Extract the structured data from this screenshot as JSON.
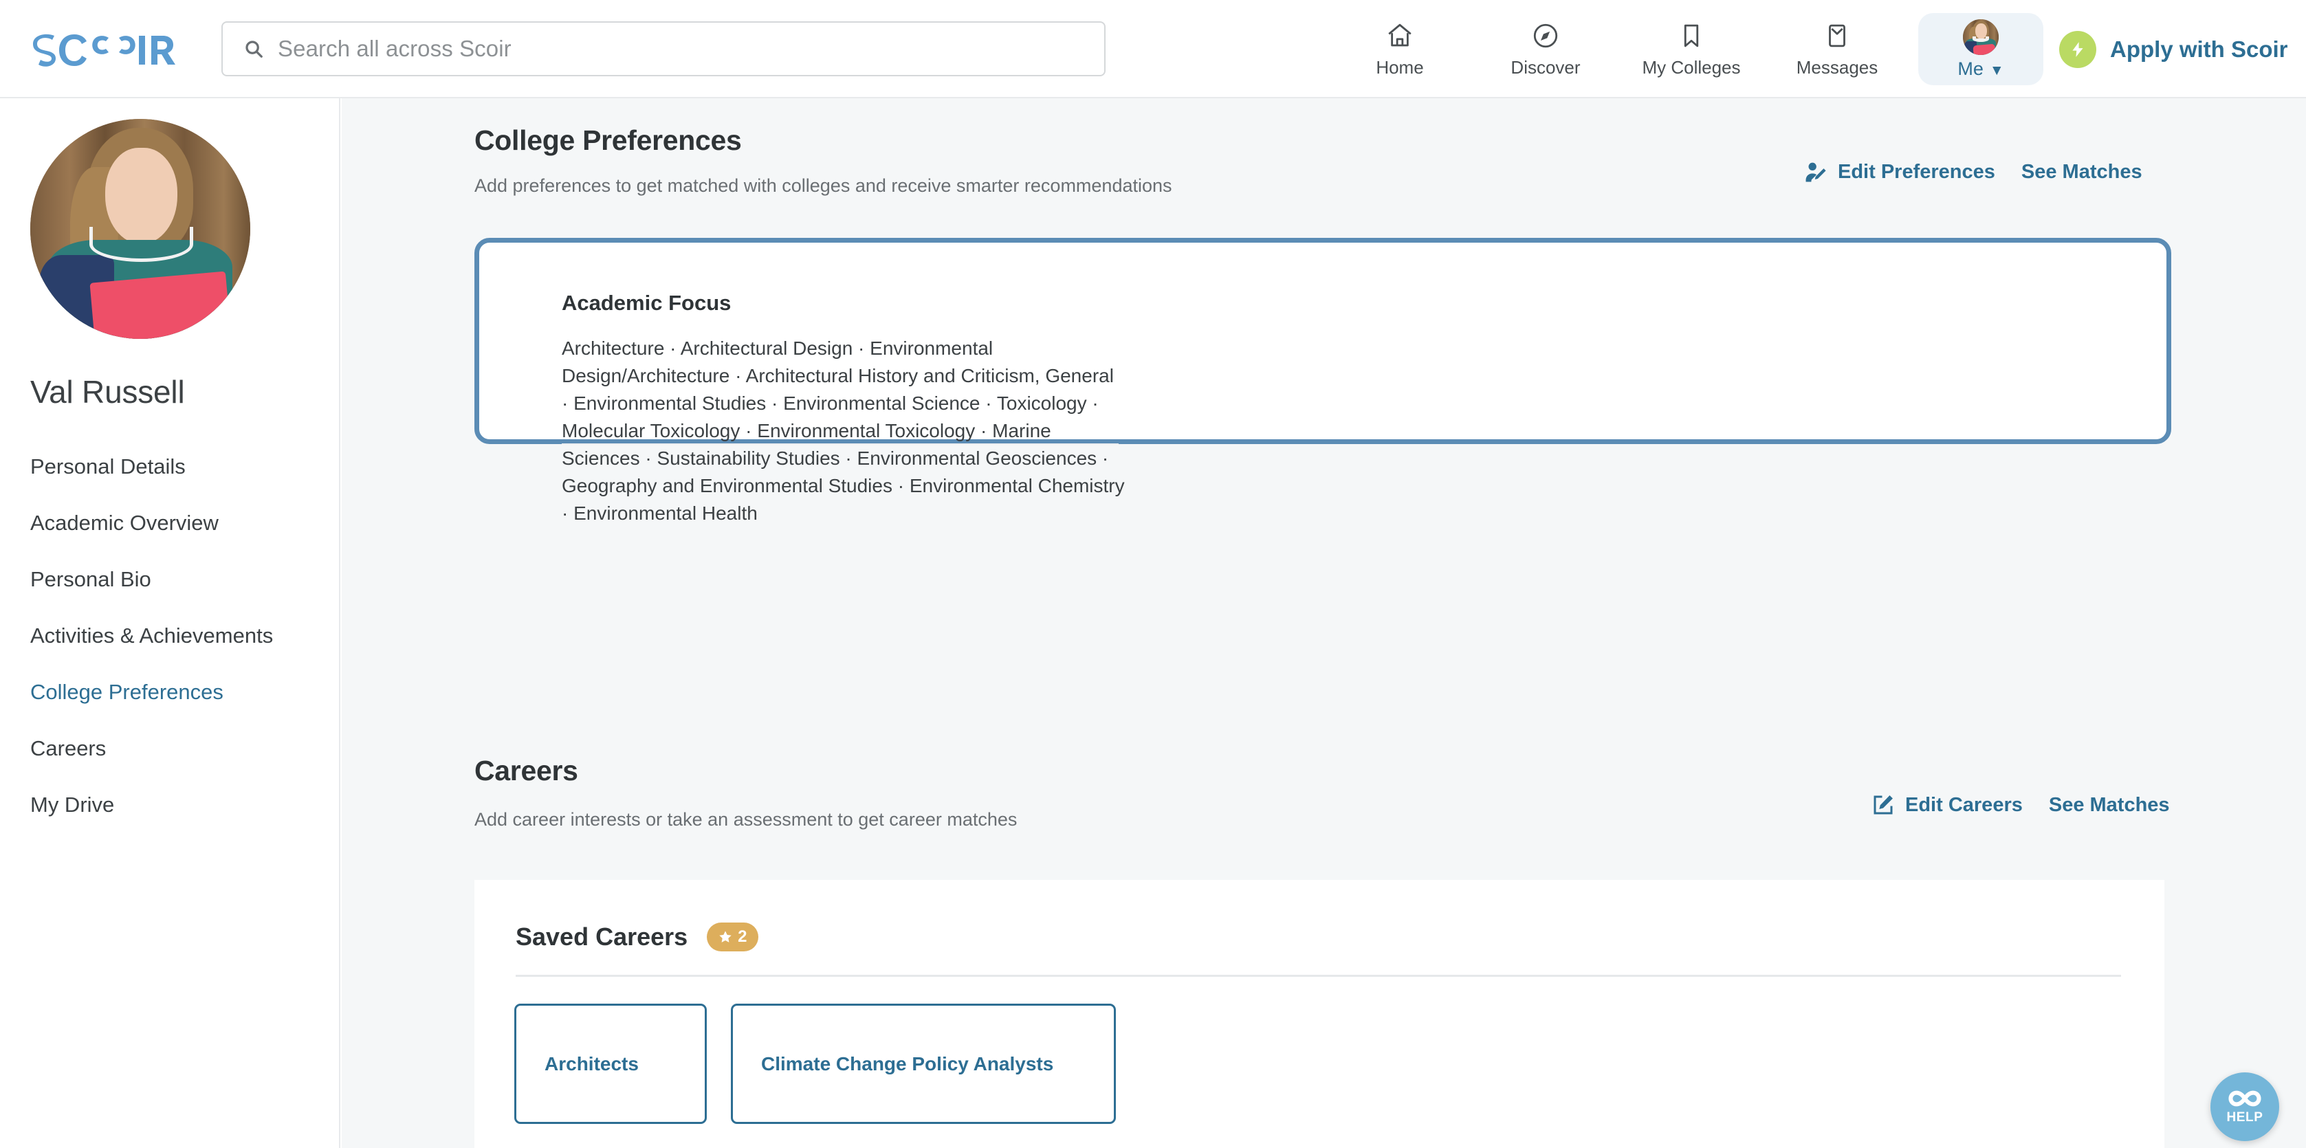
{
  "brand": {
    "logo_text": "SCOIR",
    "accent_blue": "#5b9bd0",
    "link_blue": "#2d6e93",
    "card_border_blue": "#5b8cb5",
    "badge_gold": "#ddae5c",
    "apply_green": "#bada63",
    "help_blue": "#74b6d9",
    "page_bg": "#f5f7f8"
  },
  "search": {
    "placeholder": "Search all across Scoir",
    "icon": "search-icon",
    "value": ""
  },
  "topnav": {
    "items": [
      {
        "label": "Home",
        "icon": "home-icon"
      },
      {
        "label": "Discover",
        "icon": "compass-icon"
      },
      {
        "label": "My Colleges",
        "icon": "bookmark-icon"
      },
      {
        "label": "Messages",
        "icon": "envelope-icon"
      }
    ],
    "me": {
      "label": "Me",
      "caret": "▼",
      "icon": "avatar-icon"
    },
    "apply": {
      "label": "Apply with Scoir",
      "icon": "lightning-bolt-icon"
    }
  },
  "sidebar": {
    "profile_name": "Val Russell",
    "avatar": "profile-photo",
    "items": [
      {
        "label": "Personal Details",
        "active": false
      },
      {
        "label": "Academic Overview",
        "active": false
      },
      {
        "label": "Personal Bio",
        "active": false
      },
      {
        "label": "Activities & Achievements",
        "active": false
      },
      {
        "label": "College Preferences",
        "active": true
      },
      {
        "label": "Careers",
        "active": false
      },
      {
        "label": "My Drive",
        "active": false
      }
    ]
  },
  "college_preferences": {
    "title": "College Preferences",
    "subtitle": "Add preferences to get matched with colleges and receive smarter recommendations",
    "edit_label": "Edit Preferences",
    "edit_icon": "person-edit-icon",
    "see_matches_label": "See Matches",
    "card": {
      "heading": "Academic Focus",
      "body": "Architecture · Architectural Design · Environmental Design/Architecture · Architectural History and Criticism, General · Environmental Studies · Environmental Science · Toxicology · Molecular Toxicology · Environmental Toxicology · Marine Sciences · Sustainability Studies · Environmental Geosciences · Geography and Environmental Studies · Environmental Chemistry · Environmental Health"
    }
  },
  "careers": {
    "title": "Careers",
    "subtitle": "Add career interests or take an assessment to get career matches",
    "edit_label": "Edit Careers",
    "edit_icon": "square-pencil-icon",
    "see_matches_label": "See Matches",
    "saved": {
      "heading": "Saved Careers",
      "badge_icon": "star-icon",
      "badge_count": "2",
      "tiles": [
        {
          "label": "Architects"
        },
        {
          "label": "Climate Change Policy Analysts"
        }
      ]
    }
  },
  "help": {
    "label": "HELP",
    "icon": "scoir-infinity-icon"
  }
}
